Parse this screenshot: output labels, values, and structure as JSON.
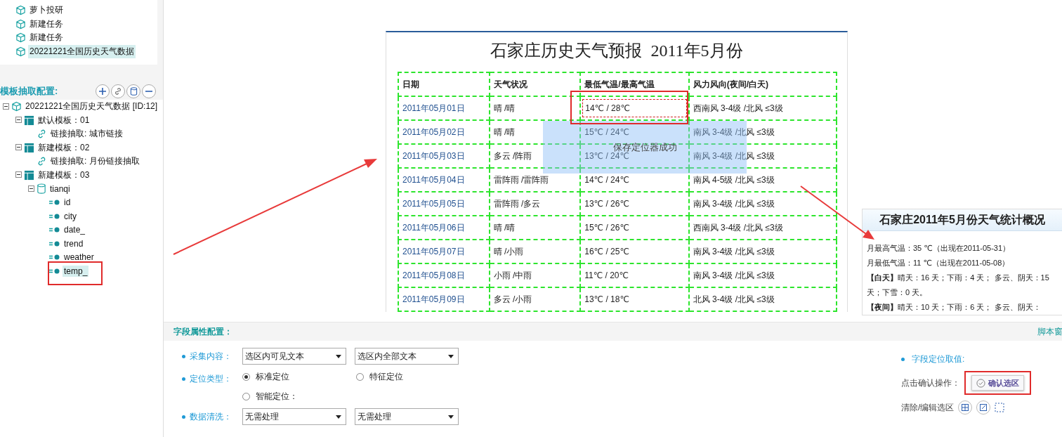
{
  "task_list": [
    {
      "label": "萝卜投研",
      "selected": false
    },
    {
      "label": "新建任务",
      "selected": false
    },
    {
      "label": "新建任务",
      "selected": false
    },
    {
      "label": "20221221全国历史天气数据",
      "selected": true
    }
  ],
  "template_config": {
    "title": "模板抽取配置:",
    "tree": [
      {
        "kind": "task",
        "label": "20221221全国历史天气数据 [ID:12]",
        "expanded": true,
        "selected": false,
        "children": [
          {
            "kind": "template",
            "label": "默认模板：01",
            "expanded": true,
            "selected": false,
            "children": [
              {
                "kind": "link",
                "label": "链接抽取: 城市链接",
                "selected": false
              }
            ]
          },
          {
            "kind": "template",
            "label": "新建模板：02",
            "expanded": true,
            "selected": false,
            "children": [
              {
                "kind": "link",
                "label": "链接抽取: 月份链接抽取",
                "selected": false
              }
            ]
          },
          {
            "kind": "template",
            "label": "新建模板：03",
            "expanded": true,
            "selected": false,
            "children": [
              {
                "kind": "table",
                "label": "tianqi",
                "expanded": true,
                "selected": false,
                "children": [
                  {
                    "kind": "field",
                    "label": "id",
                    "selected": false
                  },
                  {
                    "kind": "field",
                    "label": "city",
                    "selected": false
                  },
                  {
                    "kind": "field",
                    "label": "date_",
                    "selected": false
                  },
                  {
                    "kind": "field",
                    "label": "trend",
                    "selected": false
                  },
                  {
                    "kind": "field",
                    "label": "weather",
                    "selected": false
                  },
                  {
                    "kind": "field",
                    "label": "temp_",
                    "selected": true
                  }
                ]
              }
            ]
          }
        ]
      }
    ]
  },
  "page": {
    "title": "石家庄历史天气预报  2011年5月份",
    "columns": [
      "日期",
      "天气状况",
      "最低气温/最高气温",
      "风力风向(夜间/白天)"
    ],
    "rows": [
      {
        "date": "2011年05月01日",
        "weather": "晴 /晴",
        "temp": "14℃ / 28℃",
        "wind": "西南风 3-4级 /北风 ≤3级",
        "selected": true
      },
      {
        "date": "2011年05月02日",
        "weather": "晴 /晴",
        "temp": "15℃ / 24℃",
        "wind": "南风 3-4级 /北风 ≤3级",
        "selected": false
      },
      {
        "date": "2011年05月03日",
        "weather": "多云 /阵雨",
        "temp": "13℃ / 24℃",
        "wind": "南风 3-4级 /北风 ≤3级",
        "selected": false
      },
      {
        "date": "2011年05月04日",
        "weather": "雷阵雨 /雷阵雨",
        "temp": "14℃ / 24℃",
        "wind": "南风 4-5级 /北风 ≤3级",
        "selected": false
      },
      {
        "date": "2011年05月05日",
        "weather": "雷阵雨 /多云",
        "temp": "13℃ / 26℃",
        "wind": "南风 3-4级 /北风 ≤3级",
        "selected": false
      },
      {
        "date": "2011年05月06日",
        "weather": "晴 /晴",
        "temp": "15℃ / 26℃",
        "wind": "西南风 3-4级 /北风 ≤3级",
        "selected": false
      },
      {
        "date": "2011年05月07日",
        "weather": "晴 /小雨",
        "temp": "16℃ / 25℃",
        "wind": "南风 3-4级 /北风 ≤3级",
        "selected": false
      },
      {
        "date": "2011年05月08日",
        "weather": "小雨 /中雨",
        "temp": "11℃ / 20℃",
        "wind": "南风 3-4级 /北风 ≤3级",
        "selected": false
      },
      {
        "date": "2011年05月09日",
        "weather": "多云 /小雨",
        "temp": "13℃ / 18℃",
        "wind": "北风 3-4级 /北风 ≤3级",
        "selected": false
      }
    ]
  },
  "toast": "保存定位器成功",
  "stats": {
    "title": "石家庄2011年5月份天气统计概况",
    "lines": [
      "月最高气温：35 ℃（出现在2011-05-31）",
      "月最低气温：11 ℃（出现在2011-05-08）",
      "**【白天】**晴天：16 天；下雨：4 天； 多云、阴天：15 天；下雪：0 天。",
      "**【夜间】**晴天：10 天；下雨：6 天； 多云、阴天："
    ]
  },
  "field_config": {
    "title": "字段属性配置：",
    "script_link": "脚本窗",
    "rows": [
      {
        "kind": "selects",
        "label": "采集内容：",
        "options": [
          "选区内可见文本",
          "选区内全部文本"
        ]
      },
      {
        "kind": "radios",
        "label": "定位类型：",
        "options": [
          {
            "label": "标准定位",
            "selected": true
          },
          {
            "label": "特征定位",
            "selected": false
          },
          {
            "label": "智能定位：",
            "selected": false
          }
        ]
      },
      {
        "kind": "selects",
        "label": "数据清洗：",
        "options": [
          "无需处理",
          "无需处理"
        ]
      }
    ]
  },
  "locator": {
    "title": "字段定位取值:",
    "confirm_label": "点击确认操作：",
    "confirm_button": "确认选区",
    "clear_label": "清除/编辑选区"
  }
}
